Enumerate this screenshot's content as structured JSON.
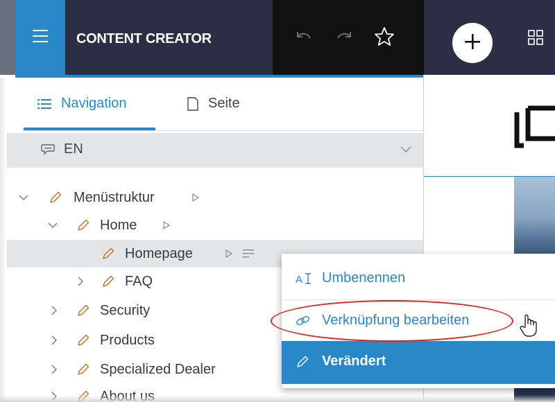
{
  "header": {
    "app_title": "CONTENT CREATOR",
    "icons": [
      "menu-icon",
      "undo-icon",
      "redo-icon",
      "star-icon",
      "plus-icon",
      "grid-icon"
    ],
    "accent_color": "#2a87c8"
  },
  "tabs": {
    "navigation_label": "Navigation",
    "page_label": "Seite"
  },
  "language": {
    "selected": "EN"
  },
  "tree": {
    "root": "Menüstruktur",
    "home": "Home",
    "homepage": "Homepage",
    "faq": "FAQ",
    "security": "Security",
    "products": "Products",
    "dealer": "Specialized Dealer",
    "about": "About us"
  },
  "context_menu": {
    "rename": "Umbenennen",
    "edit_link": "Verknüpfung bearbeiten",
    "changed": "Verändert",
    "highlight_color": "#e2231a"
  }
}
